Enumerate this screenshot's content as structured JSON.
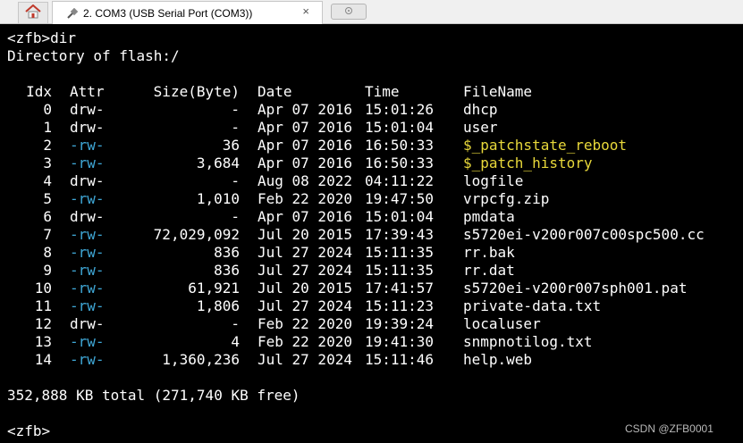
{
  "tabbar": {
    "home_icon": "home-icon",
    "tab": {
      "icon": "serial-port-icon",
      "label": "2. COM3  (USB Serial Port (COM3))",
      "close_label": "×"
    },
    "new_tab_icon": "new-tab-icon"
  },
  "terminal": {
    "command_line": "<zfb>dir",
    "directory_line": "Directory of flash:/",
    "headers": {
      "idx": "Idx",
      "attr": "Attr",
      "size": "Size(Byte)",
      "date": "Date",
      "time": "Time",
      "filename": "FileName"
    },
    "rows": [
      {
        "idx": "0",
        "attr": "drw-",
        "size": "-",
        "date": "Apr 07 2016",
        "time": "15:01:26",
        "filename": "dhcp"
      },
      {
        "idx": "1",
        "attr": "drw-",
        "size": "-",
        "date": "Apr 07 2016",
        "time": "15:01:04",
        "filename": "user"
      },
      {
        "idx": "2",
        "attr": "-rw-",
        "size": "36",
        "date": "Apr 07 2016",
        "time": "16:50:33",
        "filename": "$_patchstate_reboot"
      },
      {
        "idx": "3",
        "attr": "-rw-",
        "size": "3,684",
        "date": "Apr 07 2016",
        "time": "16:50:33",
        "filename": "$_patch_history"
      },
      {
        "idx": "4",
        "attr": "drw-",
        "size": "-",
        "date": "Aug 08 2022",
        "time": "04:11:22",
        "filename": "logfile"
      },
      {
        "idx": "5",
        "attr": "-rw-",
        "size": "1,010",
        "date": "Feb 22 2020",
        "time": "19:47:50",
        "filename": "vrpcfg.zip"
      },
      {
        "idx": "6",
        "attr": "drw-",
        "size": "-",
        "date": "Apr 07 2016",
        "time": "15:01:04",
        "filename": "pmdata"
      },
      {
        "idx": "7",
        "attr": "-rw-",
        "size": "72,029,092",
        "date": "Jul 20 2015",
        "time": "17:39:43",
        "filename": "s5720ei-v200r007c00spc500.cc"
      },
      {
        "idx": "8",
        "attr": "-rw-",
        "size": "836",
        "date": "Jul 27 2024",
        "time": "15:11:35",
        "filename": "rr.bak"
      },
      {
        "idx": "9",
        "attr": "-rw-",
        "size": "836",
        "date": "Jul 27 2024",
        "time": "15:11:35",
        "filename": "rr.dat"
      },
      {
        "idx": "10",
        "attr": "-rw-",
        "size": "61,921",
        "date": "Jul 20 2015",
        "time": "17:41:57",
        "filename": "s5720ei-v200r007sph001.pat"
      },
      {
        "idx": "11",
        "attr": "-rw-",
        "size": "1,806",
        "date": "Jul 27 2024",
        "time": "15:11:23",
        "filename": "private-data.txt"
      },
      {
        "idx": "12",
        "attr": "drw-",
        "size": "-",
        "date": "Feb 22 2020",
        "time": "19:39:24",
        "filename": "localuser"
      },
      {
        "idx": "13",
        "attr": "-rw-",
        "size": "4",
        "date": "Feb 22 2020",
        "time": "19:41:30",
        "filename": "snmpnotilog.txt"
      },
      {
        "idx": "14",
        "attr": "-rw-",
        "size": "1,360,236",
        "date": "Jul 27 2024",
        "time": "15:11:46",
        "filename": "help.web"
      }
    ],
    "total_line": "352,888 KB total (271,740 KB free)",
    "prompt": "<zfb>"
  },
  "colors": {
    "background": "#000000",
    "text": "#ffffff",
    "attr_rw": "#3fa7d6",
    "highlight_file": "#e8d83a"
  },
  "watermark": "CSDN @ZFB0001"
}
